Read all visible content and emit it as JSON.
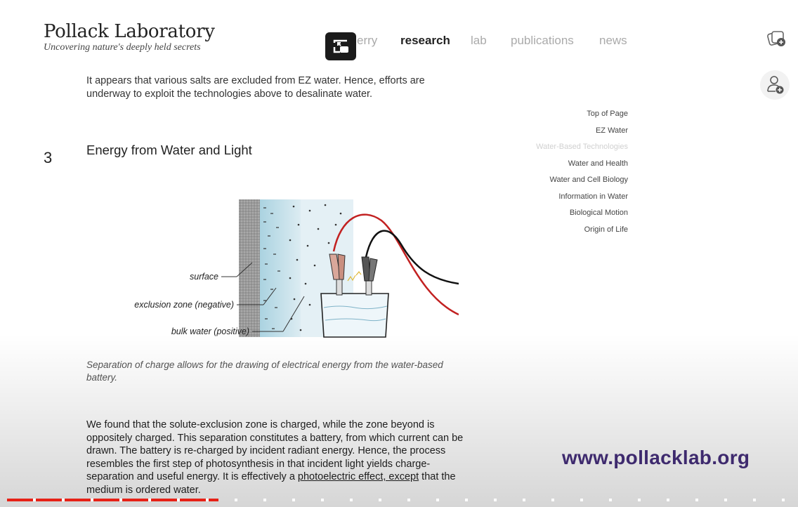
{
  "site": {
    "title": "Pollack Laboratory",
    "tagline": "Uncovering nature's deeply held secrets"
  },
  "nav": {
    "items": [
      {
        "label": "erry"
      },
      {
        "label": "research",
        "active": true
      },
      {
        "label": "lab"
      },
      {
        "label": "publications"
      },
      {
        "label": "news"
      }
    ]
  },
  "content": {
    "intro": "It appears that various salts are excluded from EZ water. Hence, efforts are underway to exploit the technologies above to desalinate water.",
    "section_number": "3",
    "section_title": "Energy from Water and Light",
    "figure_labels": {
      "surface": "surface",
      "exclusion_zone": "exclusion zone (negative)",
      "bulk_water": "bulk water (positive)"
    },
    "caption": "Separation of charge allows for the drawing of electrical energy from the water-based battery.",
    "body_main": "We found that the solute-exclusion zone is charged, while the zone beyond is oppositely charged. This separation constitutes a battery, from which current can be drawn. The battery is re-charged by incident radiant energy. Hence, the process resembles the first step of photosynthesis in that incident light yields charge-separation and useful energy. It is effectively a ",
    "body_link": "photoelectric effect, except",
    "body_end": " that the medium is ordered water."
  },
  "toc": {
    "items": [
      {
        "label": "Top of Page"
      },
      {
        "label": "EZ Water"
      },
      {
        "label": "Water-Based Technologies",
        "faded": true
      },
      {
        "label": "Water and Health"
      },
      {
        "label": "Water and Cell Biology"
      },
      {
        "label": "Information in Water"
      },
      {
        "label": "Biological Motion"
      },
      {
        "label": "Origin of Life"
      }
    ]
  },
  "watermark": "www.pollacklab.org",
  "player": {
    "progress_fraction": 0.27,
    "accent": "#e62117"
  },
  "icons": {
    "pip": "picture-in-picture-icon",
    "header_right": "add-to-queue-icon",
    "profile": "add-user-icon"
  }
}
